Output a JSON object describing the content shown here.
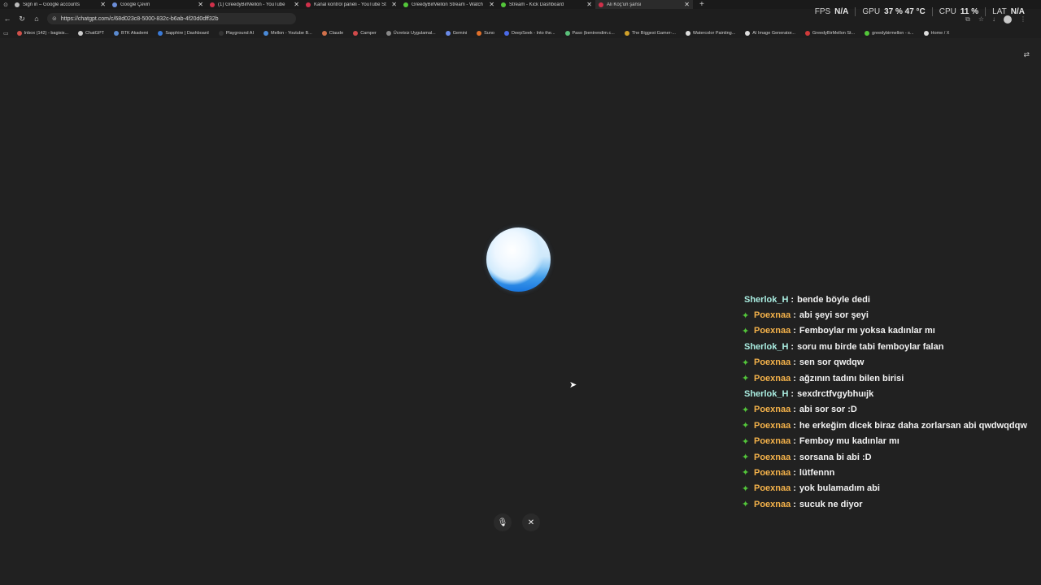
{
  "colors": {
    "background": "#212121",
    "chrome": "#1a1a1a",
    "badge_green": "#53c63a",
    "user_sherlok": "#a9ece0",
    "user_poexnaa": "#f4b24a",
    "orb_blue": "#1977e0"
  },
  "browser": {
    "tabs": [
      {
        "title": "Sign in – Google accounts",
        "favicon_color": "#bbbbbb",
        "close": "✕"
      },
      {
        "title": "Google Çeviri",
        "favicon_color": "#6c8ed8",
        "close": "✕"
      },
      {
        "title": "(1) GreedyBirMellon - YouTube",
        "favicon_color": "#d0304a",
        "close": "✕"
      },
      {
        "title": "Kanal kontrol paneli - YouTube St",
        "favicon_color": "#d0304a",
        "close": "✕"
      },
      {
        "title": "GreedyBirMellon Stream - Watch",
        "favicon_color": "#53c63a",
        "close": "✕"
      },
      {
        "title": "Stream - Kick Dashboard",
        "favicon_color": "#53c63a",
        "close": "✕"
      },
      {
        "title": "Ali Koç'un şansı",
        "favicon_color": "#d0304a",
        "close": "✕"
      }
    ],
    "new_tab": "+",
    "url": "https://chatgpt.com/c/68d023c8-5000-832c-b6ab-4f20d0dff32b",
    "bookmarks": [
      {
        "label": "Inbox (142) - bagisis...",
        "color": "#d0504a"
      },
      {
        "label": "ChatGPT",
        "color": "#cccccc"
      },
      {
        "label": "BTK Akademi",
        "color": "#5a8ad0"
      },
      {
        "label": "Sapphire | Dashboard",
        "color": "#3a7ad8"
      },
      {
        "label": "Playground AI",
        "color": "#333333"
      },
      {
        "label": "Mellon - Youtube B...",
        "color": "#4a8ad8"
      },
      {
        "label": "Claude",
        "color": "#d0704a"
      },
      {
        "label": "Camper",
        "color": "#d04a4a"
      },
      {
        "label": "Ücretsiz Uygulamal...",
        "color": "#888888"
      },
      {
        "label": "Gemini",
        "color": "#6a8ae8"
      },
      {
        "label": "Suno",
        "color": "#e0702a"
      },
      {
        "label": "DeepSeek - Into the...",
        "color": "#4a6ae8"
      },
      {
        "label": "Paso (bentrendim.c...",
        "color": "#5ac07a"
      },
      {
        "label": "The Biggest Gamer-...",
        "color": "#d0a02a"
      },
      {
        "label": "Watercolor Painting...",
        "color": "#dddddd"
      },
      {
        "label": "AI Image Generator...",
        "color": "#dddddd"
      },
      {
        "label": "GreedyBirMellon St...",
        "color": "#d03a3a"
      },
      {
        "label": "greedybirmellon - s...",
        "color": "#53c63a"
      },
      {
        "label": "Home / X",
        "color": "#dddddd"
      }
    ]
  },
  "overlay": {
    "fps_label": "FPS",
    "fps_value": "N/A",
    "gpu_label": "GPU",
    "gpu_value": "37 %  47 °C",
    "cpu_label": "CPU",
    "cpu_value": "11 %",
    "lat_label": "LAT",
    "lat_value": "N/A"
  },
  "voice": {
    "mic_icon": "🎙",
    "close_icon": "✕"
  },
  "chat": {
    "badge_glyph": "✦",
    "separator": ":",
    "messages": [
      {
        "user": "Sherlok_H",
        "badge": false,
        "text": "bende böyle dedi"
      },
      {
        "user": "Poexnaa",
        "badge": true,
        "text": "abi şeyi sor şeyi"
      },
      {
        "user": "Poexnaa",
        "badge": true,
        "text": "Femboylar mı yoksa kadınlar mı"
      },
      {
        "user": "Sherlok_H",
        "badge": false,
        "text": "soru mu birde tabi femboylar falan"
      },
      {
        "user": "Poexnaa",
        "badge": true,
        "text": "sen sor qwdqw"
      },
      {
        "user": "Poexnaa",
        "badge": true,
        "text": "ağzının tadını bilen birisi"
      },
      {
        "user": "Sherlok_H",
        "badge": false,
        "text": "sexdrctfvgybhuıjk"
      },
      {
        "user": "Poexnaa",
        "badge": true,
        "text": "abi sor sor :D"
      },
      {
        "user": "Poexnaa",
        "badge": true,
        "text": "he erkeğim dicek biraz daha zorlarsan abi qwdwqdqw"
      },
      {
        "user": "Poexnaa",
        "badge": true,
        "text": "Femboy mu kadınlar mı"
      },
      {
        "user": "Poexnaa",
        "badge": true,
        "text": "sorsana bi abi :D"
      },
      {
        "user": "Poexnaa",
        "badge": true,
        "text": "lütfennn"
      },
      {
        "user": "Poexnaa",
        "badge": true,
        "text": "yok bulamadım abi"
      },
      {
        "user": "Poexnaa",
        "badge": true,
        "text": "sucuk ne diyor"
      }
    ]
  }
}
